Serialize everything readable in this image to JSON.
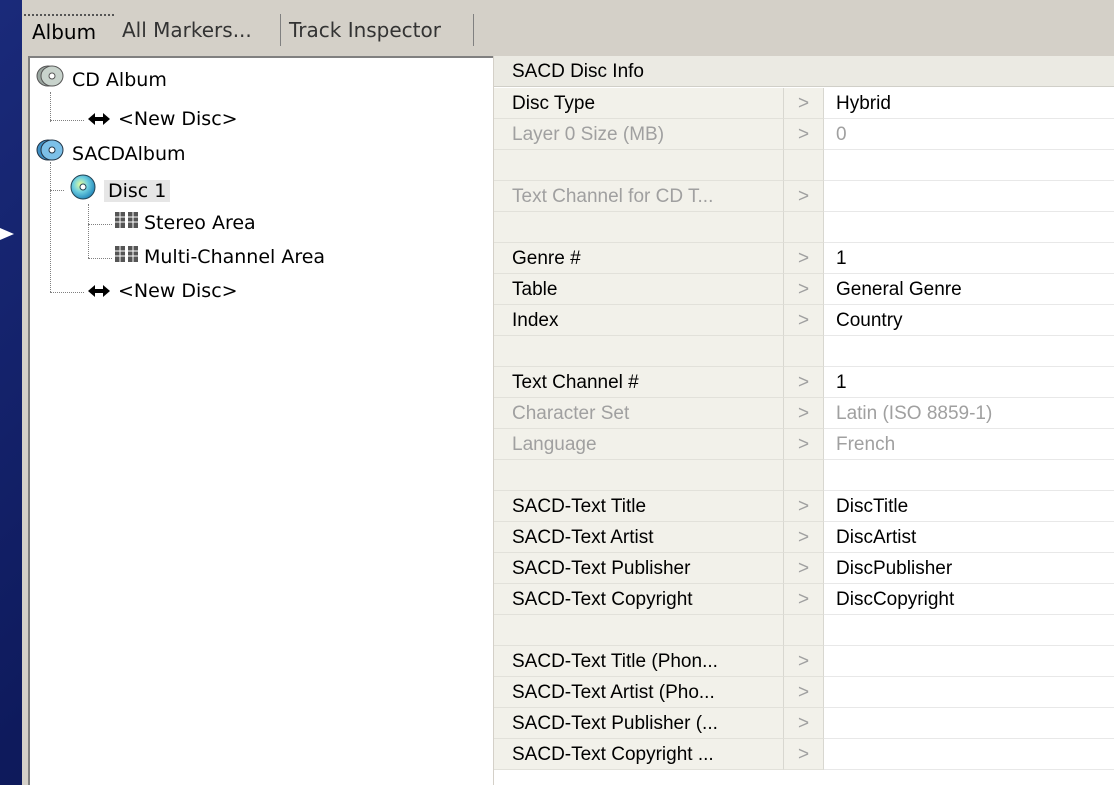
{
  "tabs": [
    {
      "label": "Album"
    },
    {
      "label": "All Markers..."
    },
    {
      "label": "Track Inspector"
    }
  ],
  "tree": {
    "cd_album": "CD Album",
    "new_disc_1": "<New Disc>",
    "sacd_album": "SACDAlbum",
    "disc1": "Disc 1",
    "stereo_area": "Stereo Area",
    "multichannel_area": "Multi-Channel Area",
    "new_disc_2": "<New Disc>"
  },
  "grid": {
    "header": "SACD Disc Info",
    "rows": [
      {
        "label": "Disc Type",
        "arrow": ">",
        "value": "Hybrid"
      },
      {
        "label": "Layer 0 Size (MB)",
        "arrow": ">",
        "value": "0"
      },
      {
        "label": "",
        "arrow": "",
        "value": ""
      },
      {
        "label": "Text Channel for CD T...",
        "arrow": ">",
        "value": ""
      },
      {
        "label": "",
        "arrow": "",
        "value": ""
      },
      {
        "label": "Genre #",
        "arrow": ">",
        "value": "1"
      },
      {
        "label": "Table",
        "arrow": ">",
        "value": "General Genre"
      },
      {
        "label": "Index",
        "arrow": ">",
        "value": "Country"
      },
      {
        "label": "",
        "arrow": "",
        "value": ""
      },
      {
        "label": "Text Channel #",
        "arrow": ">",
        "value": "1"
      },
      {
        "label": "Character Set",
        "arrow": ">",
        "value": "Latin (ISO 8859-1)"
      },
      {
        "label": "Language",
        "arrow": ">",
        "value": "French"
      },
      {
        "label": "",
        "arrow": "",
        "value": ""
      },
      {
        "label": "SACD-Text Title",
        "arrow": ">",
        "value": "DiscTitle"
      },
      {
        "label": "SACD-Text Artist",
        "arrow": ">",
        "value": "DiscArtist"
      },
      {
        "label": "SACD-Text Publisher",
        "arrow": ">",
        "value": "DiscPublisher"
      },
      {
        "label": "SACD-Text Copyright",
        "arrow": ">",
        "value": "DiscCopyright"
      },
      {
        "label": "",
        "arrow": "",
        "value": ""
      },
      {
        "label": "SACD-Text Title (Phon...",
        "arrow": ">",
        "value": ""
      },
      {
        "label": "SACD-Text Artist (Pho...",
        "arrow": ">",
        "value": ""
      },
      {
        "label": "SACD-Text Publisher (...",
        "arrow": ">",
        "value": ""
      },
      {
        "label": "SACD-Text Copyright ...",
        "arrow": ">",
        "value": ""
      }
    ]
  }
}
